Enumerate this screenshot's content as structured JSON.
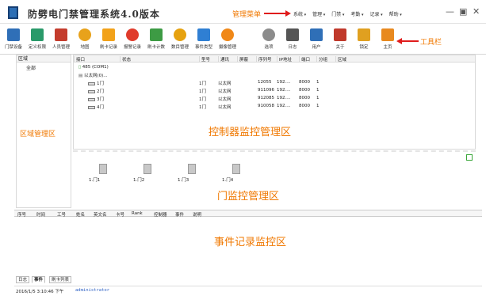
{
  "app": {
    "title": "防劈电门禁管理系统4.0版本"
  },
  "annotations": {
    "menu": "管理菜单",
    "toolbar": "工具栏",
    "area": "区域管理区",
    "controller": "控制器监控管理区",
    "door": "门监控管理区",
    "event": "事件记录监控区"
  },
  "menus": [
    "系统",
    "管理",
    "门禁",
    "考勤",
    "记录",
    "帮助"
  ],
  "window_controls": {
    "min": "—",
    "max": "▣",
    "close": "✕"
  },
  "toolbar": [
    {
      "label": "门禁设备",
      "icon": "device-icon",
      "color": "#2f6fb7"
    },
    {
      "label": "定义权限",
      "icon": "sync-icon",
      "color": "#2a9a6a"
    },
    {
      "label": "人员管理",
      "icon": "people-icon",
      "color": "#c43c2d"
    },
    {
      "label": "地图",
      "icon": "globe-icon",
      "color": "#e8a21b"
    },
    {
      "label": "刷卡记录",
      "icon": "star-icon",
      "color": "#f2a21a"
    },
    {
      "label": "报警记录",
      "icon": "alert-icon",
      "color": "#e03b2b"
    },
    {
      "label": "刷卡计数",
      "icon": "count-icon",
      "color": "#3d9b44"
    },
    {
      "label": "数目管理",
      "icon": "clock-icon",
      "color": "#e6a210"
    },
    {
      "label": "事件类型",
      "icon": "chart-icon",
      "color": "#2f7fd3"
    },
    {
      "label": "摄像管理",
      "icon": "camera-icon",
      "color": "#f08818"
    },
    {
      "label": "选项",
      "icon": "gear-icon",
      "color": "#8c8c8c"
    },
    {
      "label": "日志",
      "icon": "calendar-icon",
      "color": "#555555"
    },
    {
      "label": "用户",
      "icon": "user-icon",
      "color": "#2f6fb7"
    },
    {
      "label": "关于",
      "icon": "umbrella-icon",
      "color": "#c0392b"
    },
    {
      "label": "锁定",
      "icon": "lock-icon",
      "color": "#e0a020"
    },
    {
      "label": "主页",
      "icon": "home-icon",
      "color": "#e8891f"
    }
  ],
  "area": {
    "header": "区域",
    "item": "全部"
  },
  "controller": {
    "columns": [
      "接口",
      "状态",
      "型号",
      "通讯",
      "屏蔽",
      "序列号",
      "IP地址",
      "端口",
      "分组",
      "区域"
    ],
    "interface": "485 (COM1)",
    "network": "以太网(0)...",
    "rows": [
      {
        "name": "1门",
        "model": "1门",
        "comm": "以太网",
        "serial": "12055",
        "ip": "192....",
        "port": "8000",
        "group": "1"
      },
      {
        "name": "2门",
        "model": "1门",
        "comm": "以太网",
        "serial": "911096",
        "ip": "192....",
        "port": "8000",
        "group": "1"
      },
      {
        "name": "3门",
        "model": "1门",
        "comm": "以太网",
        "serial": "912085",
        "ip": "192....",
        "port": "8000",
        "group": "1"
      },
      {
        "name": "4门",
        "model": "1门",
        "comm": "以太网",
        "serial": "910058",
        "ip": "192....",
        "port": "8000",
        "group": "1"
      }
    ]
  },
  "doors": [
    "1.门1",
    "1.门2",
    "1.门3",
    "1.门4"
  ],
  "events": {
    "columns": [
      "序号",
      "时间",
      "工号",
      "姓名",
      "英文名",
      "卡号",
      "Rank",
      "控制器",
      "事件",
      "说明"
    ]
  },
  "bottom_tabs": [
    "日志",
    "事件",
    "刷卡列表"
  ],
  "status": {
    "time": "2016/1/5 3:10:46 下午",
    "user": "administrator"
  }
}
